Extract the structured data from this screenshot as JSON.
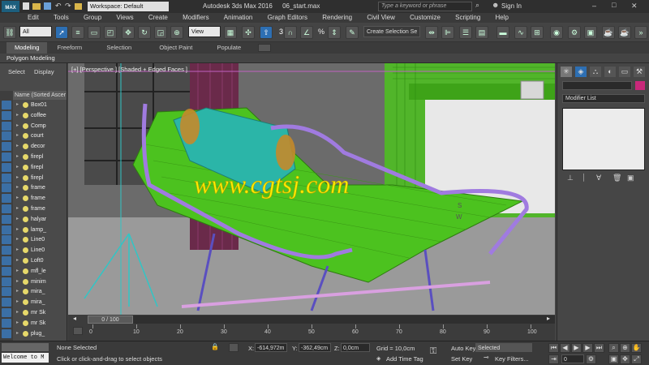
{
  "titlebar": {
    "app_badge": "MAX",
    "workspace": "Workspace: Default",
    "title": "Autodesk 3ds Max 2016",
    "filename": "06_start.max",
    "search_placeholder": "Type a keyword or phrase",
    "sign_in": "Sign In",
    "win_min": "–",
    "win_max": "□",
    "win_close": "✕"
  },
  "menu": [
    "Edit",
    "Tools",
    "Group",
    "Views",
    "Create",
    "Modifiers",
    "Animation",
    "Graph Editors",
    "Rendering",
    "Civil View",
    "Customize",
    "Scripting",
    "Help"
  ],
  "toolbar": {
    "filter": "All",
    "refcoord": "View",
    "snap_num": "3",
    "percent": "%",
    "selection_set_placeholder": "Create Selection Se"
  },
  "ribbon": {
    "tabs": [
      "Modeling",
      "Freeform",
      "Selection",
      "Object Paint",
      "Populate"
    ],
    "active": "Modeling",
    "sub": "Polygon Modeling"
  },
  "scene_explorer": {
    "tabs": [
      "Select",
      "Display"
    ],
    "column": "Name (Sorted Ascer",
    "items": [
      "Box01",
      "coffee",
      "Comp",
      "court",
      "decor",
      "firepl",
      "firepl",
      "firepl",
      "frame",
      "frame",
      "frame",
      "halyar",
      "lamp_",
      "Line0",
      "Line0",
      "Loft0",
      "mfl_le",
      "minim",
      "mira_",
      "mira_",
      "mr Sk",
      "mr Sk",
      "plug_"
    ]
  },
  "viewport": {
    "label": "[+] [Perspective ] [Shaded + Edged Faces ]",
    "watermark": "www.cgtsj.com",
    "wall_letter_s": "S",
    "wall_letter_w": "W"
  },
  "command_panel": {
    "modifier_list": "Modifier List"
  },
  "timeline": {
    "frame_label": "0 / 100",
    "frames": [
      "0",
      "10",
      "20",
      "30",
      "40",
      "50",
      "60",
      "70",
      "80",
      "90",
      "100"
    ]
  },
  "status": {
    "maxscript": "Welcome to M",
    "selection": "None Selected",
    "prompt": "Click or click-and-drag to select objects",
    "x_label": "X:",
    "x_value": "-614,972m",
    "y_label": "Y:",
    "y_value": "-362,49cm",
    "z_label": "Z:",
    "z_value": "0,0cm",
    "grid": "Grid = 10,0cm",
    "add_time_tag": "Add Time Tag",
    "auto_key": "Auto Key",
    "set_key": "Set Key",
    "key_mode": "Selected",
    "key_filters": "Key Filters...",
    "current_frame": "0"
  },
  "colors": {
    "viewport_bg": "#6e6e6e",
    "mesh_green": "#4cc21f",
    "mesh_cyan": "#2bb5a8",
    "frame_purple": "#7b5fd6",
    "accent_blue": "#2d6fb3",
    "watermark": "#ffee00"
  }
}
